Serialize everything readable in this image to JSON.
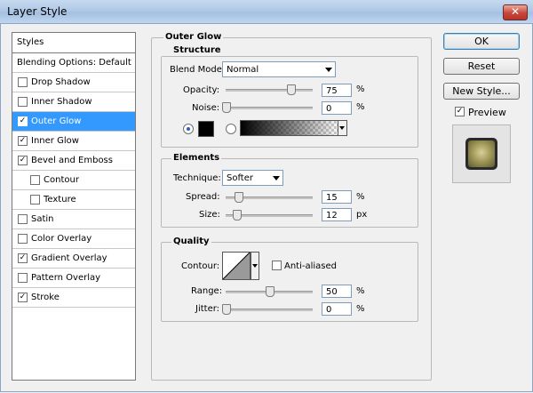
{
  "window": {
    "title": "Layer Style",
    "close": "✕"
  },
  "styles_panel": {
    "header": "Styles",
    "blending": "Blending Options: Default",
    "items": [
      {
        "label": "Drop Shadow",
        "checked": false
      },
      {
        "label": "Inner Shadow",
        "checked": false
      },
      {
        "label": "Outer Glow",
        "checked": true,
        "selected": true
      },
      {
        "label": "Inner Glow",
        "checked": true
      },
      {
        "label": "Bevel and Emboss",
        "checked": true
      },
      {
        "label": "Contour",
        "checked": false,
        "indent": true
      },
      {
        "label": "Texture",
        "checked": false,
        "indent": true
      },
      {
        "label": "Satin",
        "checked": false
      },
      {
        "label": "Color Overlay",
        "checked": false
      },
      {
        "label": "Gradient Overlay",
        "checked": true
      },
      {
        "label": "Pattern Overlay",
        "checked": false
      },
      {
        "label": "Stroke",
        "checked": true
      }
    ]
  },
  "main": {
    "title": "Outer Glow",
    "structure": {
      "title": "Structure",
      "blend_mode_label": "Blend Mode:",
      "blend_mode_value": "Normal",
      "opacity_label": "Opacity:",
      "opacity_value": "75",
      "noise_label": "Noise:",
      "noise_value": "0",
      "percent": "%",
      "glow_color": "#000000"
    },
    "elements": {
      "title": "Elements",
      "technique_label": "Technique:",
      "technique_value": "Softer",
      "spread_label": "Spread:",
      "spread_value": "15",
      "size_label": "Size:",
      "size_value": "12",
      "percent": "%",
      "px": "px"
    },
    "quality": {
      "title": "Quality",
      "contour_label": "Contour:",
      "antialiased_label": "Anti-aliased",
      "antialiased_checked": false,
      "range_label": "Range:",
      "range_value": "50",
      "jitter_label": "Jitter:",
      "jitter_value": "0",
      "percent": "%"
    }
  },
  "buttons": {
    "ok": "OK",
    "reset": "Reset",
    "new_style": "New Style...",
    "preview_label": "Preview",
    "preview_checked": true
  },
  "colors": {
    "accent": "#3399ff",
    "titlebar": "#b1c9e6"
  }
}
